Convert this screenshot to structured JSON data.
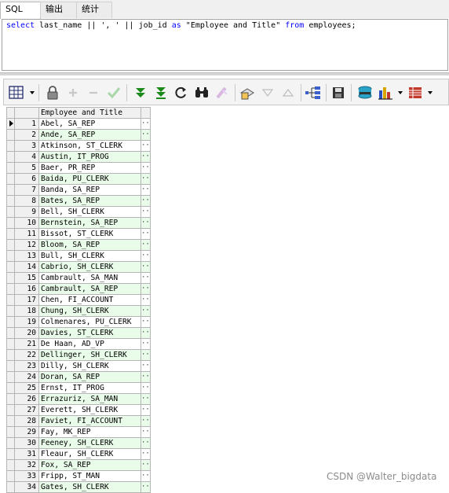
{
  "tabs": [
    {
      "label": "SQL",
      "active": true
    },
    {
      "label": "输出",
      "active": false
    },
    {
      "label": "统计",
      "active": false
    }
  ],
  "editor": {
    "sql_parts": [
      "select",
      " last_name || ', ' || job_id ",
      "as",
      " \"Employee and Title\" ",
      "from",
      " employees;"
    ]
  },
  "toolbar": {
    "icons": [
      "grid-layout-icon",
      "lock-icon",
      "add-row-icon",
      "delete-row-icon",
      "post-changes-icon",
      "fetch-next-icon",
      "fetch-last-icon",
      "refresh-icon",
      "find-icon",
      "clear-icon",
      "query-by-example-icon",
      "filter-down-icon",
      "filter-up-icon",
      "tree-view-icon",
      "save-icon",
      "export-icon",
      "chart-icon",
      "grid-options-icon"
    ]
  },
  "grid": {
    "column_header": "Employee and Title",
    "rows": [
      {
        "n": "1",
        "value": "Abel, SA_REP"
      },
      {
        "n": "2",
        "value": "Ande, SA_REP"
      },
      {
        "n": "3",
        "value": "Atkinson, ST_CLERK"
      },
      {
        "n": "4",
        "value": "Austin, IT_PROG"
      },
      {
        "n": "5",
        "value": "Baer, PR_REP"
      },
      {
        "n": "6",
        "value": "Baida, PU_CLERK"
      },
      {
        "n": "7",
        "value": "Banda, SA_REP"
      },
      {
        "n": "8",
        "value": "Bates, SA_REP"
      },
      {
        "n": "9",
        "value": "Bell, SH_CLERK"
      },
      {
        "n": "10",
        "value": "Bernstein, SA_REP"
      },
      {
        "n": "11",
        "value": "Bissot, ST_CLERK"
      },
      {
        "n": "12",
        "value": "Bloom, SA_REP"
      },
      {
        "n": "13",
        "value": "Bull, SH_CLERK"
      },
      {
        "n": "14",
        "value": "Cabrio, SH_CLERK"
      },
      {
        "n": "15",
        "value": "Cambrault, SA_MAN"
      },
      {
        "n": "16",
        "value": "Cambrault, SA_REP"
      },
      {
        "n": "17",
        "value": "Chen, FI_ACCOUNT"
      },
      {
        "n": "18",
        "value": "Chung, SH_CLERK"
      },
      {
        "n": "19",
        "value": "Colmenares, PU_CLERK"
      },
      {
        "n": "20",
        "value": "Davies, ST_CLERK"
      },
      {
        "n": "21",
        "value": "De Haan, AD_VP"
      },
      {
        "n": "22",
        "value": "Dellinger, SH_CLERK"
      },
      {
        "n": "23",
        "value": "Dilly, SH_CLERK"
      },
      {
        "n": "24",
        "value": "Doran, SA_REP"
      },
      {
        "n": "25",
        "value": "Ernst, IT_PROG"
      },
      {
        "n": "26",
        "value": "Errazuriz, SA_MAN"
      },
      {
        "n": "27",
        "value": "Everett, SH_CLERK"
      },
      {
        "n": "28",
        "value": "Faviet, FI_ACCOUNT"
      },
      {
        "n": "29",
        "value": "Fay, MK_REP"
      },
      {
        "n": "30",
        "value": "Feeney, SH_CLERK"
      },
      {
        "n": "31",
        "value": "Fleaur, SH_CLERK"
      },
      {
        "n": "32",
        "value": "Fox, SA_REP"
      },
      {
        "n": "33",
        "value": "Fripp, ST_MAN"
      },
      {
        "n": "34",
        "value": "Gates, SH_CLERK"
      }
    ],
    "cell_button": "···",
    "row_colors": {
      "odd": "#ffffff",
      "even": "#e9fbe9"
    }
  },
  "watermark": "CSDN @Walter_bigdata",
  "colors": {
    "keyword": "#0000ff",
    "accent_green": "#1a8a1a"
  }
}
